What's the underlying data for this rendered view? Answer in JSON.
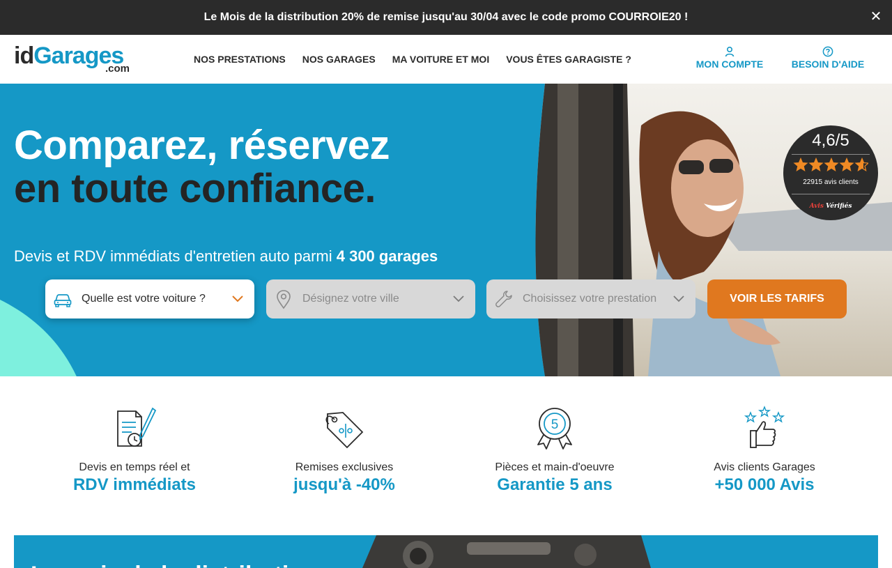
{
  "promo": {
    "text": "Le Mois de la distribution 20% de remise jusqu'au 30/04 avec le code promo COURROIE20 !",
    "close_label": "✕"
  },
  "header": {
    "logo": {
      "id": "id",
      "garages": "Garages",
      "com": ".com"
    },
    "nav": [
      {
        "label": "NOS PRESTATIONS"
      },
      {
        "label": "NOS GARAGES"
      },
      {
        "label": "MA VOITURE ET MOI"
      },
      {
        "label": "VOUS ÊTES GARAGISTE ?"
      }
    ],
    "account_label": "MON COMPTE",
    "help_label": "BESOIN D'AIDE"
  },
  "hero": {
    "title_line1": "Comparez, réservez",
    "title_line2": "en toute confiance.",
    "subtitle_prefix": "Devis et RDV immédiats d'entretien auto parmi",
    "subtitle_strong": "4 300 garages",
    "search": {
      "car_label": "Quelle est votre voiture ?",
      "city_placeholder": "Désignez votre ville",
      "service_placeholder": "Choisissez votre prestation",
      "cta_label": "VOIR LES TARIFS"
    },
    "rating": {
      "score": "4,6/5",
      "value": 4.6,
      "max": 5,
      "count_text": "22915 avis clients",
      "brand_prefix": "Avis",
      "brand_suffix": "Vérifiés"
    }
  },
  "features": [
    {
      "icon": "quote-document-icon",
      "line1": "Devis en temps réel et",
      "line2": "RDV immédiats"
    },
    {
      "icon": "discount-tag-icon",
      "line1": "Remises exclusives",
      "line2": "jusqu'à -40%"
    },
    {
      "icon": "warranty-badge-icon",
      "badge_number": "5",
      "line1": "Pièces et main-d'oeuvre",
      "line2": "Garantie 5 ans"
    },
    {
      "icon": "thumbs-up-stars-icon",
      "line1": "Avis clients Garages",
      "line2": "+50 000 Avis"
    }
  ],
  "teaser": {
    "text": "Le mois de la distribution"
  },
  "colors": {
    "brand_blue": "#1598c6",
    "dark": "#2b2b2b",
    "cta_orange": "#e0781f",
    "accent_teal": "#7ef0de",
    "star_orange": "#f08a24"
  }
}
